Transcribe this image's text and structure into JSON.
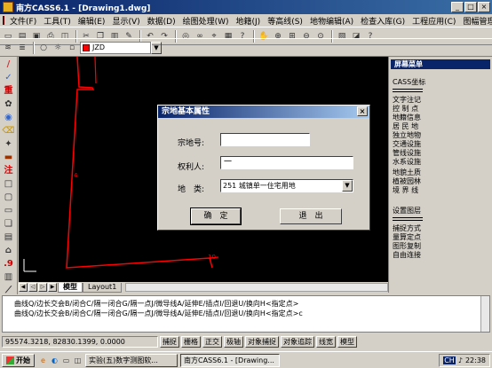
{
  "window": {
    "title": "南方CASS6.1 - [Drawing1.dwg]",
    "controls": [
      "_",
      "□",
      "×"
    ]
  },
  "menubar": {
    "items": [
      "文件(F)",
      "工具(T)",
      "编辑(E)",
      "显示(V)",
      "数据(D)",
      "绘图处理(W)",
      "地籍(J)",
      "等高线(S)",
      "地物编辑(A)",
      "检查入库(G)",
      "工程应用(C)",
      "图幅管理(M)"
    ]
  },
  "toolbar": {
    "layer_name": "JZD"
  },
  "canvas": {
    "background": "#000000",
    "line_color": "#ff0000",
    "labels": {
      "left": "4",
      "bottom": "10"
    }
  },
  "layout_tabs": {
    "model": "模型",
    "layout1": "Layout1"
  },
  "screen_menu": {
    "title": "屏幕菜单",
    "section1": [
      "CASS坐标"
    ],
    "section2": [
      "文字注记",
      "控 制 点",
      "地籍信息",
      "居 民 地",
      "独立地物",
      "交通设施",
      "管线设施",
      "水系设施",
      "境界线",
      "地貌土质",
      "植被园林"
    ],
    "section2_display": [
      "文字注记",
      "控 制 点",
      "地籍信息",
      "居 民 地",
      "独立地物",
      "交通设施",
      "管线设施",
      "水系设施",
      "地貌土质",
      "植被园林",
      "境 界 线"
    ],
    "section3": [
      "设置图层",
      "捕捉方式",
      "量算定点",
      "图形复制",
      "自由连接"
    ]
  },
  "command": {
    "lines": [
      "曲线Q/边长交会B/闭合C/隔一闭合G/隔一点J/微导线A/延伸E/插点I/回退U/换向H<指定点>",
      "曲线Q/边长交会B/闭合C/隔一闭合G/隔一点J/微导线A/延伸E/插点I/回退U/换向H<指定点>c"
    ]
  },
  "status": {
    "coords": "95574.3218, 82830.1399, 0.0000",
    "buttons": [
      "捕捉",
      "栅格",
      "正交",
      "极轴",
      "对象捕捉",
      "对象追踪",
      "线宽",
      "模型"
    ]
  },
  "dialog": {
    "title": "宗地基本属性",
    "close": "×",
    "parcel_no_label": "宗地号:",
    "parcel_no_value": "",
    "owner_label": "权利人:",
    "owner_value": "一",
    "type_label": "地　类:",
    "type_value": "251 城镇单一住宅用地",
    "ok_label": "确　定",
    "cancel_label": "退　出"
  },
  "taskbar": {
    "start": "开始",
    "items": [
      "实验(五)数字测图软...",
      "南方CASS6.1 - [Drawing..."
    ],
    "tray_ch": "CH",
    "clock": "22:38"
  }
}
